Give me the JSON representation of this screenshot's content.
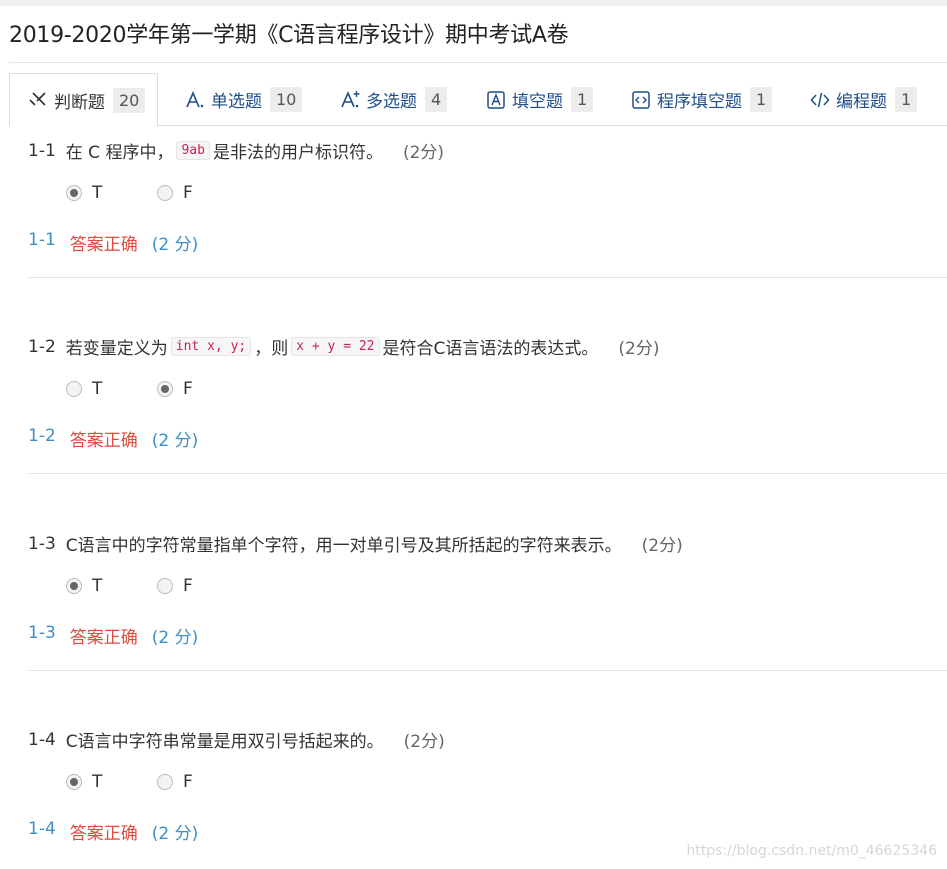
{
  "page": {
    "title": "2019-2020学年第一学期《C语言程序设计》期中考试A卷",
    "watermark": "https://blog.csdn.net/m0_46625346"
  },
  "tabs": [
    {
      "label": "判断题",
      "count": "20",
      "icon": "judge-icon",
      "active": true
    },
    {
      "label": "单选题",
      "count": "10",
      "icon": "single-choice-icon"
    },
    {
      "label": "多选题",
      "count": "4",
      "icon": "multi-choice-icon"
    },
    {
      "label": "填空题",
      "count": "1",
      "icon": "fill-blank-icon"
    },
    {
      "label": "程序填空题",
      "count": "1",
      "icon": "program-fill-icon"
    },
    {
      "label": "编程题",
      "count": "1",
      "icon": "code-icon"
    }
  ],
  "questions": [
    {
      "num": "1-1",
      "parts": [
        "在 C 程序中，",
        "9ab",
        "是非法的用户标识符。"
      ],
      "score": "(2分)",
      "options": [
        "T",
        "F"
      ],
      "selected": "T",
      "result_num": "1-1",
      "result_text": "答案正确",
      "result_points": "(2 分)"
    },
    {
      "num": "1-2",
      "parts": [
        "若变量定义为",
        "int x, y;",
        "，则",
        "x + y = 22",
        "是符合C语言语法的表达式。"
      ],
      "score": "(2分)",
      "options": [
        "T",
        "F"
      ],
      "selected": "F",
      "result_num": "1-2",
      "result_text": "答案正确",
      "result_points": "(2 分)"
    },
    {
      "num": "1-3",
      "parts": [
        "C语言中的字符常量指单个字符，用一对单引号及其所括起的字符来表示。"
      ],
      "score": "(2分)",
      "options": [
        "T",
        "F"
      ],
      "selected": "T",
      "result_num": "1-3",
      "result_text": "答案正确",
      "result_points": "(2 分)"
    },
    {
      "num": "1-4",
      "parts": [
        "C语言中字符串常量是用双引号括起来的。"
      ],
      "score": "(2分)",
      "options": [
        "T",
        "F"
      ],
      "selected": "T",
      "result_num": "1-4",
      "result_text": "答案正确",
      "result_points": "(2 分)"
    }
  ],
  "colors": {
    "tab_link": "#1f4e8c",
    "result_num": "#3b8fc9",
    "result_ok": "#e04a3f",
    "code_text": "#c7254e"
  }
}
